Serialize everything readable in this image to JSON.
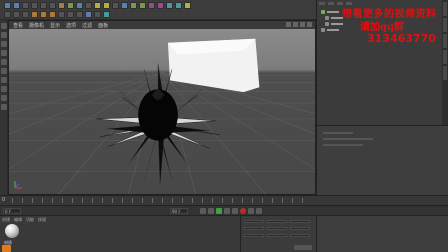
{
  "watermark": {
    "line1": "想看更多的视频资料",
    "line2": "请加qq群",
    "line3": "313463770",
    "color": "#e01010"
  },
  "viewport": {
    "menu": [
      "查看",
      "摄像机",
      "显示",
      "选项",
      "过滤",
      "面板"
    ],
    "scene_object": "black-flower-model"
  },
  "timeline": {
    "start_frame": "0"
  },
  "transport": {
    "current_frame": "0 F",
    "end_frame": "90 F"
  },
  "material_manager": {
    "menu": [
      "创建",
      "编辑",
      "功能",
      "纹理"
    ],
    "material_name": "材质"
  },
  "icons": [
    "toolbar-icons",
    "play-icon",
    "record-icon",
    "material-sphere-icon",
    "cinema4d-logo-icon"
  ]
}
